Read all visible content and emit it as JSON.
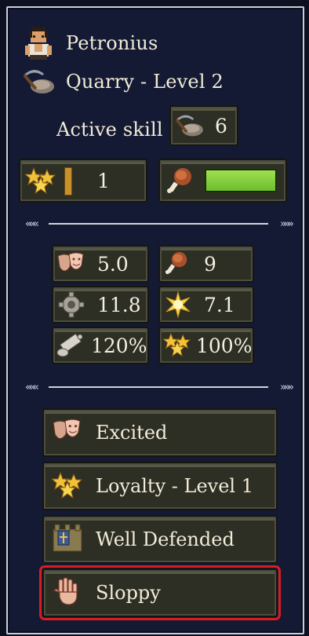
{
  "character": {
    "name": "Petronius",
    "job": "Quarry - Level 2"
  },
  "active_skill": {
    "label": "Active skill",
    "value": "6"
  },
  "status": {
    "stars_value": "1",
    "food_fill_fraction": 1.0
  },
  "stats": [
    {
      "icon": "theater-masks-icon",
      "value": "5.0"
    },
    {
      "icon": "meat-drumstick-icon",
      "value": "9"
    },
    {
      "icon": "gear-cog-icon",
      "value": "11.8"
    },
    {
      "icon": "sun-burst-icon",
      "value": "7.1"
    },
    {
      "icon": "scroll-quill-icon",
      "value": "120%"
    },
    {
      "icon": "gold-stars-icon",
      "value": "100%"
    }
  ],
  "traits": [
    {
      "icon": "theater-masks-icon",
      "label": "Excited"
    },
    {
      "icon": "gold-stars-icon",
      "label": "Loyalty - Level 1"
    },
    {
      "icon": "fortified-wall-icon",
      "label": "Well Defended"
    },
    {
      "icon": "open-hand-icon",
      "label": "Sloppy"
    }
  ],
  "colors": {
    "background": "#141a33",
    "box": "#2d2e24",
    "food_bar": "#7fd13a",
    "selection": "#d81c22",
    "text": "#f2ecd8"
  }
}
